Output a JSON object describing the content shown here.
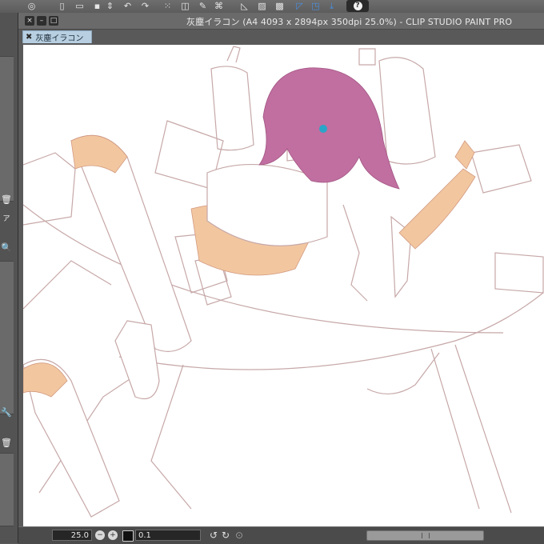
{
  "window": {
    "title": "灰塵イラコン (A4 4093 x 2894px 350dpi 25.0%)  - CLIP STUDIO PAINT PRO",
    "close_icon": "×",
    "minimize_icon": "–",
    "maximize_icon": "□"
  },
  "tab": {
    "label": "灰塵イラコン",
    "close_icon": "✖"
  },
  "toolbar": {
    "icons": [
      "swirl-logo-icon",
      "new-file-icon",
      "open-folder-icon",
      "save-icon",
      "updown-arrows-icon",
      "undo-icon",
      "redo-icon",
      "selection-dots-icon",
      "transform-icon",
      "eraser-icon",
      "fill-icon",
      "select-corner-icon",
      "ruler-icon",
      "snap-icon",
      "help-icon"
    ],
    "help_label": "?"
  },
  "status": {
    "zoom_value": "25.0",
    "brush_size": "0.1",
    "rotate_left_icon": "↺",
    "rotate_right_icon": "↻",
    "reset_icon": "⊙"
  },
  "left_panel": {
    "icons": [
      "trash-icon",
      "zoom-icon",
      "wrench-icon",
      "trash-icon"
    ],
    "label_fragment": "ア"
  },
  "colors": {
    "accent_tab": "#b7cfe1",
    "ui_dark": "#5a5a5a",
    "hair": "#c06fa0",
    "skin": "#f2c7a0",
    "lineart": "#c7a8a8"
  }
}
